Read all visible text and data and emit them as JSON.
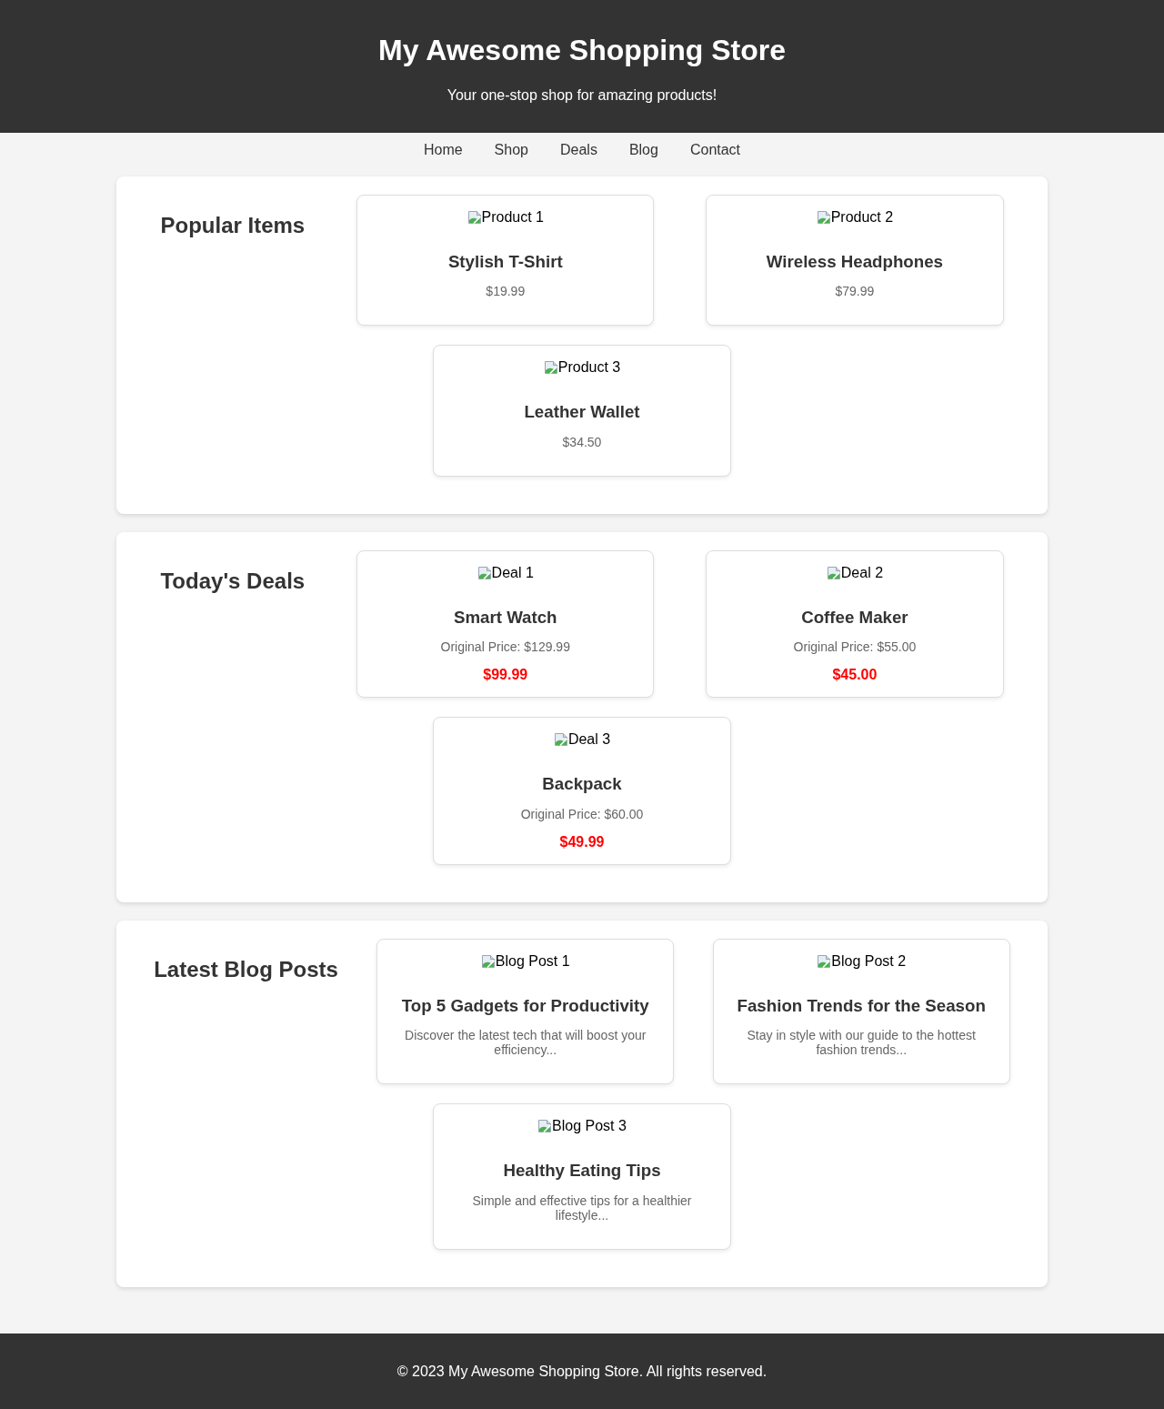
{
  "header": {
    "title": "My Awesome Shopping Store",
    "tagline": "Your one-stop shop for amazing products!"
  },
  "nav": [
    "Home",
    "Shop",
    "Deals",
    "Blog",
    "Contact"
  ],
  "sections": [
    {
      "kind": "products",
      "heading": "Popular Items",
      "cards": [
        {
          "image_alt": "Product 1",
          "title": "Stylish T-Shirt",
          "price": "$19.99"
        },
        {
          "image_alt": "Product 2",
          "title": "Wireless Headphones",
          "price": "$79.99"
        },
        {
          "image_alt": "Product 3",
          "title": "Leather Wallet",
          "price": "$34.50"
        }
      ]
    },
    {
      "kind": "deals",
      "heading": "Today's Deals",
      "cards": [
        {
          "image_alt": "Deal 1",
          "title": "Smart Watch",
          "original_price": "Original Price: $129.99",
          "sale_price": "$99.99"
        },
        {
          "image_alt": "Deal 2",
          "title": "Coffee Maker",
          "original_price": "Original Price: $55.00",
          "sale_price": "$45.00"
        },
        {
          "image_alt": "Deal 3",
          "title": "Backpack",
          "original_price": "Original Price: $60.00",
          "sale_price": "$49.99"
        }
      ]
    },
    {
      "kind": "blog",
      "heading": "Latest Blog Posts",
      "cards": [
        {
          "image_alt": "Blog Post 1",
          "title": "Top 5 Gadgets for Productivity",
          "excerpt": "Discover the latest tech that will boost your efficiency..."
        },
        {
          "image_alt": "Blog Post 2",
          "title": "Fashion Trends for the Season",
          "excerpt": "Stay in style with our guide to the hottest fashion trends..."
        },
        {
          "image_alt": "Blog Post 3",
          "title": "Healthy Eating Tips",
          "excerpt": "Simple and effective tips for a healthier lifestyle..."
        }
      ]
    }
  ],
  "footer": "© 2023 My Awesome Shopping Store. All rights reserved."
}
